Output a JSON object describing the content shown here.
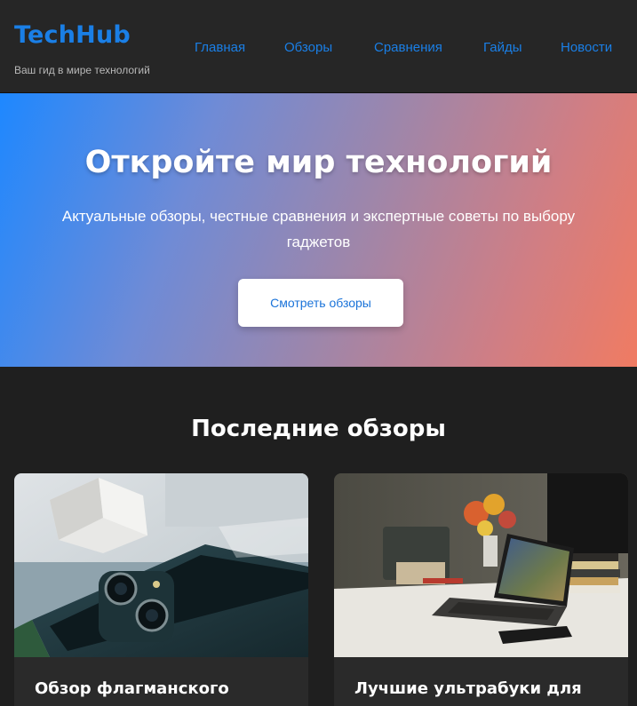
{
  "header": {
    "logo": "TechHub",
    "tagline": "Ваш гид в мире технологий",
    "nav": [
      {
        "label": "Главная"
      },
      {
        "label": "Обзоры"
      },
      {
        "label": "Сравнения"
      },
      {
        "label": "Гайды"
      },
      {
        "label": "Новости"
      }
    ]
  },
  "hero": {
    "title": "Откройте мир технологий",
    "subtitle": "Актуальные обзоры, честные сравнения и экспертные советы по выбору гаджетов",
    "button_label": "Смотреть обзоры"
  },
  "reviews": {
    "title": "Последние обзоры",
    "cards": [
      {
        "title": "Обзор флагманского",
        "image": "smartphone-photo"
      },
      {
        "title": "Лучшие ультрабуки для",
        "image": "laptop-desk-photo"
      }
    ]
  },
  "colors": {
    "accent": "#1a7fe6",
    "background": "#1f1f1f",
    "header_bg": "#262626"
  }
}
